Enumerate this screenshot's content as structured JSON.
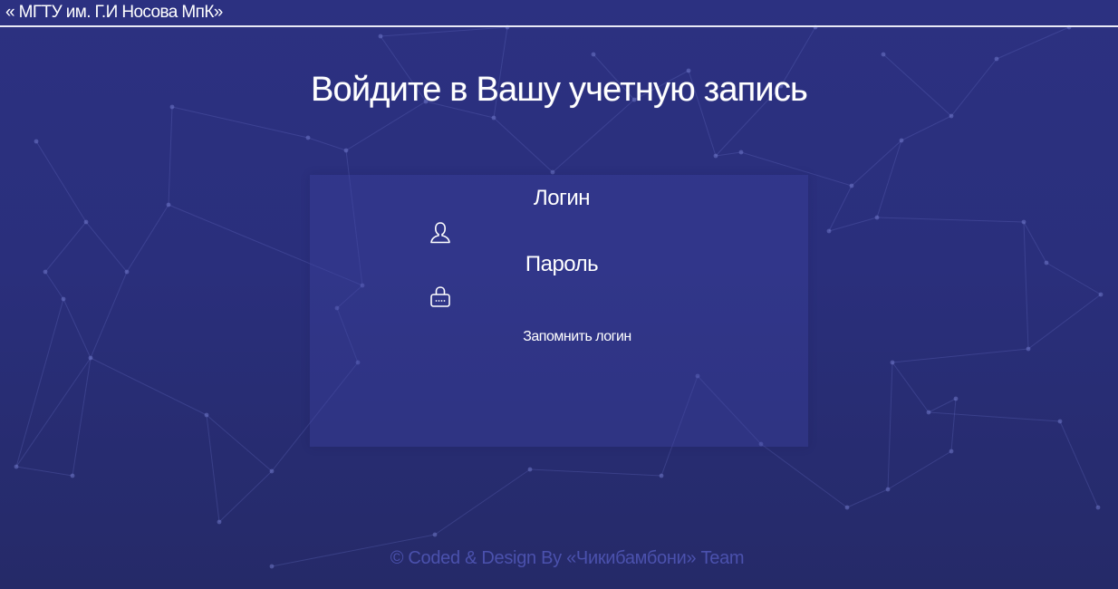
{
  "header": {
    "brand": "« МГТУ им. Г.И Носова МпК»"
  },
  "main": {
    "title": "Войдите в Вашу учетную запись"
  },
  "login_form": {
    "login_label": "Логин",
    "login_value": "",
    "login_icon": "user-icon",
    "password_label": "Пароль",
    "password_value": "",
    "password_icon": "lock-icon",
    "remember_label": "Запомнить логин"
  },
  "footer": {
    "text": "© Coded & Design By «Чикибамбони» Team"
  },
  "colors": {
    "background_top": "#2c3181",
    "background_bottom": "#252a68",
    "card": "#3c42a0",
    "footer_text": "#4b51ad",
    "text": "#ffffff"
  }
}
